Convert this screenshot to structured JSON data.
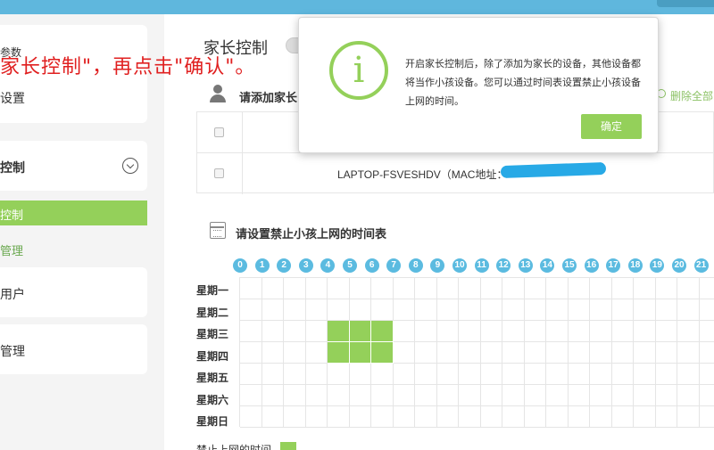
{
  "sidebar": {
    "items": [
      {
        "label": "参数"
      },
      {
        "label": "设置"
      },
      {
        "label": "控制"
      },
      {
        "label": "控制"
      },
      {
        "label": "管理"
      },
      {
        "label": "用户"
      },
      {
        "label": "管理"
      }
    ]
  },
  "annotation": "家长控制\"，再点击\"确认\"。",
  "main": {
    "title": "家长控制",
    "add_parent_heading": "请添加家长",
    "delete_all_label": "删除全部",
    "device_name": "LAPTOP-FSVESHDV（MAC地址：",
    "schedule_heading": "请设置禁止小孩上网的时间表",
    "hours": [
      "0",
      "1",
      "2",
      "3",
      "4",
      "5",
      "6",
      "7",
      "8",
      "9",
      "10",
      "11",
      "12",
      "13",
      "14",
      "15",
      "16",
      "17",
      "18",
      "19",
      "20",
      "21"
    ],
    "days": [
      "星期一",
      "星期二",
      "星期三",
      "星期四",
      "星期五",
      "星期六",
      "星期日"
    ],
    "blocked": [
      {
        "day": 2,
        "hours": [
          4,
          5,
          6
        ]
      },
      {
        "day": 3,
        "hours": [
          4,
          5,
          6
        ]
      }
    ],
    "legend_label": "禁止上网的时间"
  },
  "dialog": {
    "message": "开启家长控制后，除了添加为家长的设备，其他设备都将当作小孩设备。您可以通过时间表设置禁止小孩设备上网的时间。",
    "confirm_label": "确定"
  },
  "colors": {
    "accent_green": "#94d05a",
    "hour_blue": "#5bbbe0",
    "annotation_red": "#e02020"
  }
}
